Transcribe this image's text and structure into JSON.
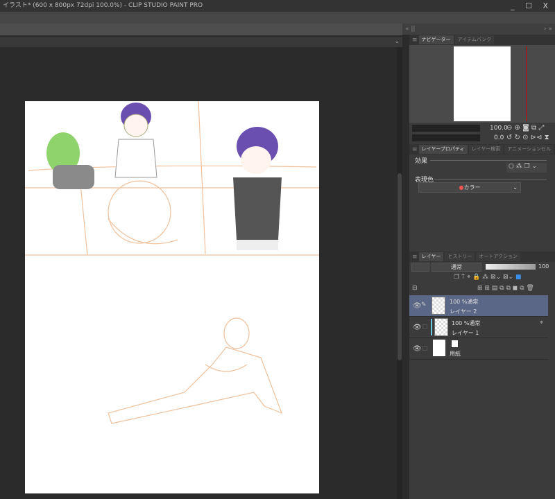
{
  "window": {
    "title": "イラスト* (600 x 800px 72dpi 100.0%)  - CLIP STUDIO PAINT PRO",
    "controls": "_ ☐ X"
  },
  "panel_strip": {
    "left": "«  ||",
    "right": "›  »"
  },
  "navigator": {
    "tabs": [
      "ナビゲーター",
      "アイテムバンク"
    ],
    "zoom": "100.0",
    "rotation": "0.0"
  },
  "layer_property": {
    "tabs": [
      "レイヤープロパティ",
      "レイヤー検索",
      "アニメーションセル"
    ],
    "effect_label": "効果",
    "color_label": "表現色",
    "color_value": "カラー"
  },
  "layers_panel": {
    "tabs": [
      "レイヤー",
      "ヒストリー",
      "オートアクション"
    ],
    "blend_mode": "通常",
    "opacity": "100",
    "layers": [
      {
        "mode": "100 %通常",
        "name": "レイヤー 2",
        "selected": true
      },
      {
        "mode": "100 %通常",
        "name": "レイヤー 1",
        "selected": false
      },
      {
        "mode": "",
        "name": "用紙",
        "selected": false
      }
    ]
  },
  "colors": {
    "accent": "#5a6787",
    "sketch": "#f0c09a"
  }
}
